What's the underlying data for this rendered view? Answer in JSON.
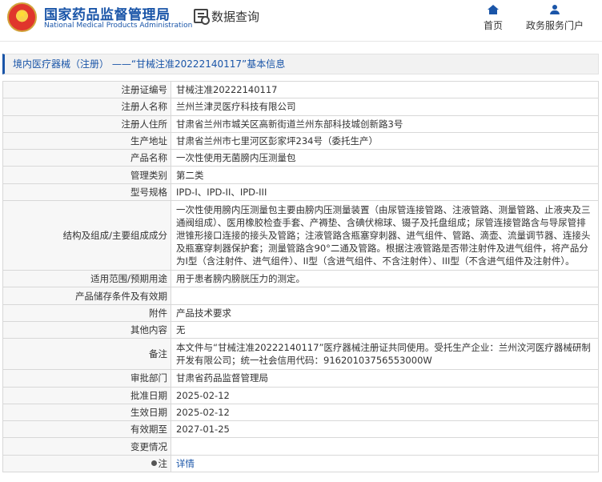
{
  "header": {
    "logo_cn": "国家药品监督管理局",
    "logo_en": "National Medical Products Administration",
    "section_title": "数据查询",
    "nav": [
      {
        "label": "首页",
        "icon": "home-icon"
      },
      {
        "label": "政务服务门户",
        "icon": "user-icon"
      }
    ],
    "brand_color": "#1a55a8"
  },
  "breadcrumb": "境内医疗器械（注册） ——“甘械注准20222140117”基本信息",
  "fields": [
    {
      "label": "注册证编号",
      "value": "甘械注准20222140117"
    },
    {
      "label": "注册人名称",
      "value": "兰州兰津灵医疗科技有限公司"
    },
    {
      "label": "注册人住所",
      "value": "甘肃省兰州市城关区高新街道兰州东部科技城创新路3号"
    },
    {
      "label": "生产地址",
      "value": "甘肃省兰州市七里河区彭家坪234号（委托生产）"
    },
    {
      "label": "产品名称",
      "value": "一次性使用无菌膀内压测量包"
    },
    {
      "label": "管理类别",
      "value": "第二类"
    },
    {
      "label": "型号规格",
      "value": "IPD-I、IPD-II、IPD-III"
    },
    {
      "label": "结构及组成/主要组成成分",
      "value": "一次性使用膀内压测量包主要由膀内压测量装置（由尿管连接管路、注液管路、测量管路、止液夹及三通阀组成）、医用橡胶检查手套、产褥垫、含碘伏棉球、镊子及托盘组成；尿管连接管路含与导尿管排泄锥形接口连接的接头及管路；注液管路含瓶塞穿刺器、进气组件、管路、滴壶、流量调节器、连接头及瓶塞穿刺器保护套；测量管路含90°二通及管路。根据注液管路是否带注射件及进气组件，将产品分为I型（含注射件、进气组件）、II型（含进气组件、不含注射件）、III型（不含进气组件及注射件）。"
    },
    {
      "label": "适用范围/预期用途",
      "value": "用于患者膀内膀胱压力的测定。"
    },
    {
      "label": "产品储存条件及有效期",
      "value": ""
    },
    {
      "label": "附件",
      "value": "产品技术要求"
    },
    {
      "label": "其他内容",
      "value": "无"
    },
    {
      "label": "备注",
      "value": "本文件与“甘械注准20222140117”医疗器械注册证共同使用。受托生产企业：兰州汶河医疗器械研制开发有限公司；统一社会信用代码：91620103756553000W"
    },
    {
      "label": "审批部门",
      "value": "甘肃省药品监督管理局"
    },
    {
      "label": "批准日期",
      "value": "2025-02-12"
    },
    {
      "label": "生效日期",
      "value": "2025-02-12"
    },
    {
      "label": "有效期至",
      "value": "2027-01-25"
    },
    {
      "label": "变更情况",
      "value": ""
    },
    {
      "label": "注",
      "value": "详情",
      "icon": "pin-icon"
    }
  ]
}
